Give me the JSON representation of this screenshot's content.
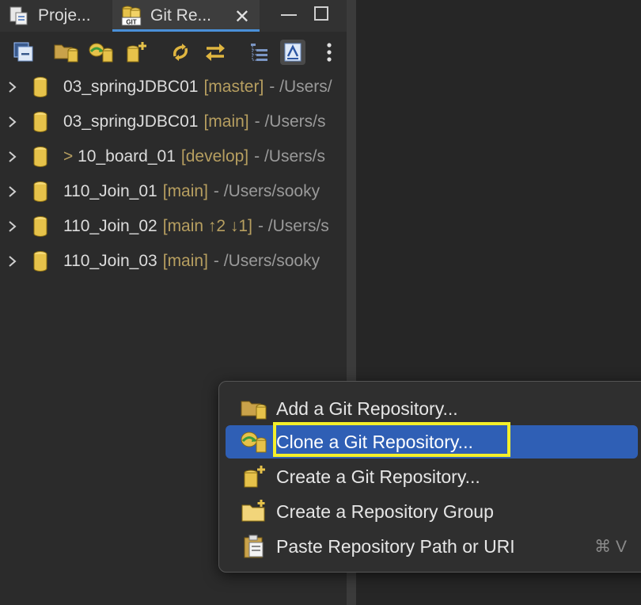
{
  "tabs": {
    "project_explorer": "Proje...",
    "git_repositories": "Git Re..."
  },
  "toolbar": {
    "icons": [
      "collapse-all-icon",
      "add-repo-icon",
      "clone-repo-icon",
      "create-repo-icon",
      "refresh-icon",
      "link-with-selection-icon",
      "hierarchical-view-icon",
      "commit-view-icon",
      "more-icon"
    ]
  },
  "tree": {
    "rows": [
      {
        "prefix": "",
        "name": "03_springJDBC01",
        "branch": "[master]",
        "path": "- /Users/"
      },
      {
        "prefix": "",
        "name": "03_springJDBC01",
        "branch": "[main]",
        "path": "- /Users/s"
      },
      {
        "prefix": "> ",
        "name": "10_board_01",
        "branch": "[develop]",
        "path": "- /Users/s"
      },
      {
        "prefix": "",
        "name": "110_Join_01",
        "branch": "[main]",
        "path": "- /Users/sooky"
      },
      {
        "prefix": "",
        "name": "110_Join_02",
        "branch": "[main ↑2 ↓1]",
        "path": "- /Users/s"
      },
      {
        "prefix": "",
        "name": "110_Join_03",
        "branch": "[main]",
        "path": "- /Users/sooky"
      }
    ]
  },
  "context_menu": {
    "items": [
      {
        "label": "Add a Git Repository...",
        "icon": "add-repo-icon",
        "shortcut": ""
      },
      {
        "label": "Clone a Git Repository...",
        "icon": "clone-repo-icon",
        "shortcut": ""
      },
      {
        "label": "Create a Git Repository...",
        "icon": "create-repo-icon",
        "shortcut": ""
      },
      {
        "label": "Create a Repository Group",
        "icon": "folder-add-icon",
        "shortcut": ""
      },
      {
        "label": "Paste Repository Path or URI",
        "icon": "paste-icon",
        "shortcut": "⌘ V"
      }
    ],
    "selected_index": 1
  },
  "colors": {
    "background": "#2b2b2b",
    "menu_selection": "#2f5fb5",
    "highlight_outline": "#f4ef2a",
    "branch_text": "#b79f60",
    "path_text": "#9a9a9a"
  }
}
